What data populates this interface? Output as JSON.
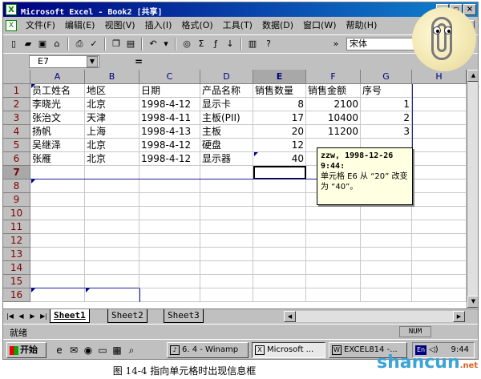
{
  "window": {
    "title": "Microsoft Excel - Book2 [共享]",
    "app_icon": "X"
  },
  "menu": [
    "文件(F)",
    "编辑(E)",
    "视图(V)",
    "插入(I)",
    "格式(O)",
    "工具(T)",
    "数据(D)",
    "窗口(W)",
    "帮助(H)"
  ],
  "toolbar": {
    "font_name": "宋体"
  },
  "formula_bar": {
    "name_box": "E7",
    "equals": "=",
    "value": ""
  },
  "columns": [
    "A",
    "B",
    "C",
    "D",
    "E",
    "F",
    "G",
    "H"
  ],
  "active_column": "E",
  "rows": [
    "1",
    "2",
    "3",
    "4",
    "5",
    "6",
    "7",
    "8",
    "9",
    "10",
    "11",
    "12",
    "13",
    "14",
    "15",
    "16"
  ],
  "active_row": "7",
  "table": {
    "headers": [
      "员工姓名",
      "地区",
      "日期",
      "产品名称",
      "销售数量",
      "销售金额",
      "序号"
    ],
    "records": [
      [
        "李晓光",
        "北京",
        "1998-4-12",
        "显示卡",
        "8",
        "2100",
        "1"
      ],
      [
        "张治文",
        "天津",
        "1998-4-11",
        "主板(PII)",
        "17",
        "10400",
        "2"
      ],
      [
        "扬帆",
        "上海",
        "1998-4-13",
        "主板",
        "20",
        "11200",
        "3"
      ],
      [
        "吴继泽",
        "北京",
        "1998-4-12",
        "硬盘",
        "12",
        "",
        ""
      ],
      [
        "张雁",
        "北京",
        "1998-4-12",
        "显示器",
        "40",
        "",
        ""
      ]
    ]
  },
  "selected_cell": "E7",
  "comment": {
    "author": "zzw, 1998-12-26",
    "time": "9:44:",
    "text": "单元格 E6 从 “20” 改变为 “40”。"
  },
  "sheet_tabs": [
    "Sheet1",
    "Sheet2",
    "Sheet3"
  ],
  "active_sheet": "Sheet1",
  "status": {
    "text": "就绪",
    "num": "NUM"
  },
  "taskbar": {
    "start": "开始",
    "tasks": [
      "6. 4 - Winamp",
      "Microsoft ...",
      "EXCEL814 -..."
    ],
    "active_task_index": 1,
    "tray_lang": "En",
    "clock": "9:44"
  },
  "caption": "图 14-4  指向单元格时出现信息框",
  "watermark": {
    "main": "shancun",
    "small": ".net"
  }
}
